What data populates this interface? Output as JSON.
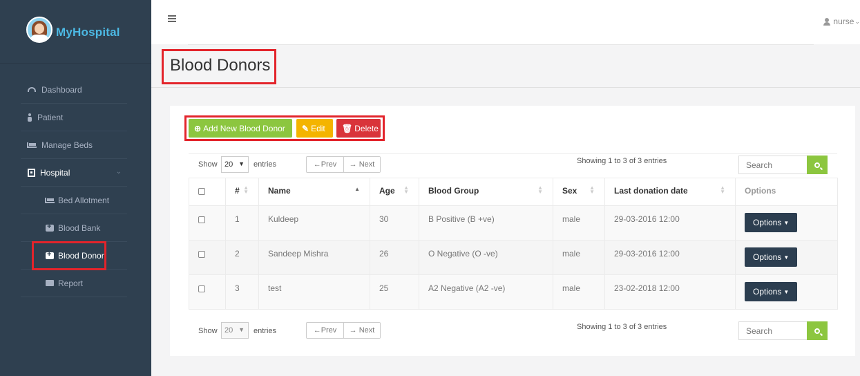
{
  "app": {
    "name": "MyHospital"
  },
  "user": {
    "name": "nurse"
  },
  "sidebar": {
    "items": [
      {
        "label": "Dashboard",
        "icon": "dashboard-icon"
      },
      {
        "label": "Patient",
        "icon": "person-icon"
      },
      {
        "label": "Manage Beds",
        "icon": "bed-icon"
      },
      {
        "label": "Hospital",
        "icon": "hospital-icon",
        "expanded": true
      }
    ],
    "subitems": [
      {
        "label": "Bed Allotment",
        "icon": "bed-icon"
      },
      {
        "label": "Blood Bank",
        "icon": "medkit-icon"
      },
      {
        "label": "Blood Donor",
        "icon": "medkit-icon",
        "active": true
      },
      {
        "label": "Report",
        "icon": "briefcase-icon"
      }
    ]
  },
  "page": {
    "title": "Blood Donors"
  },
  "toolbar": {
    "add_label": "Add New Blood Donor",
    "edit_label": "Edit",
    "delete_label": "Delete"
  },
  "controls": {
    "show_label": "Show",
    "entries_label": "entries",
    "page_size": "20",
    "prev_label": "←Prev",
    "next_label": "→ Next",
    "info": "Showing 1 to 3 of 3 entries",
    "search_placeholder": "Search"
  },
  "table": {
    "columns": [
      "#",
      "Name",
      "Age",
      "Blood Group",
      "Sex",
      "Last donation date",
      "Options"
    ],
    "rows": [
      {
        "num": "1",
        "name": "Kuldeep",
        "age": "30",
        "blood_group": "B Positive (B +ve)",
        "sex": "male",
        "last_donation": "29-03-2016 12:00",
        "options": "Options"
      },
      {
        "num": "2",
        "name": "Sandeep Mishra",
        "age": "26",
        "blood_group": "O Negative (O -ve)",
        "sex": "male",
        "last_donation": "29-03-2016 12:00",
        "options": "Options"
      },
      {
        "num": "3",
        "name": "test",
        "age": "25",
        "blood_group": "A2 Negative (A2 -ve)",
        "sex": "male",
        "last_donation": "23-02-2018 12:00",
        "options": "Options"
      }
    ]
  },
  "colors": {
    "sidebar_bg": "#2f4050",
    "add_button": "#8cc63f",
    "edit_button": "#f4b400",
    "delete_button": "#d9343a",
    "options_button": "#2c3e50",
    "highlight_box": "#e3242b"
  }
}
